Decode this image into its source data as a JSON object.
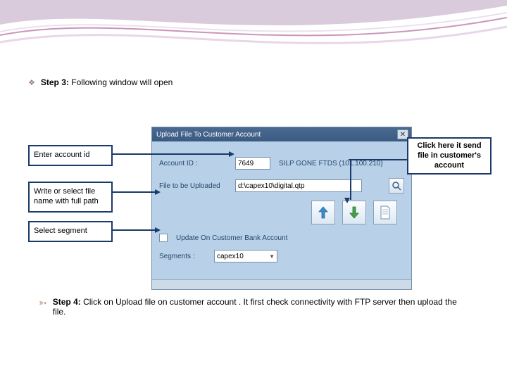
{
  "steps": {
    "step3": {
      "label": "Step 3:",
      "text": "Following window will open"
    },
    "step4": {
      "label": "Step 4:",
      "text": "Click on Upload file on customer account . It first check connectivity with FTP server  then  upload the file."
    }
  },
  "callouts": {
    "accountId": "Enter account id",
    "fileName": "Write or select file name with full path",
    "segment": "Select segment",
    "send": "Click here it send file in customer's account"
  },
  "dialog": {
    "title": "Upload File To Customer Account",
    "labels": {
      "accountId": "Account ID :",
      "fileUploaded": "File to be Uploaded",
      "updateCheck": "Update On Customer Bank Account",
      "segments": "Segments :"
    },
    "values": {
      "accountIdValue": "7649",
      "accountInfo": "SILP GONE FTDS (101.100.210)",
      "filePath": "d:\\capex10\\digital.qtp",
      "segment": "capex10"
    },
    "icons": {
      "browse": "magnifier-icon",
      "upload": "upload-arrow-icon",
      "download": "download-arrow-icon",
      "page": "document-icon"
    }
  }
}
